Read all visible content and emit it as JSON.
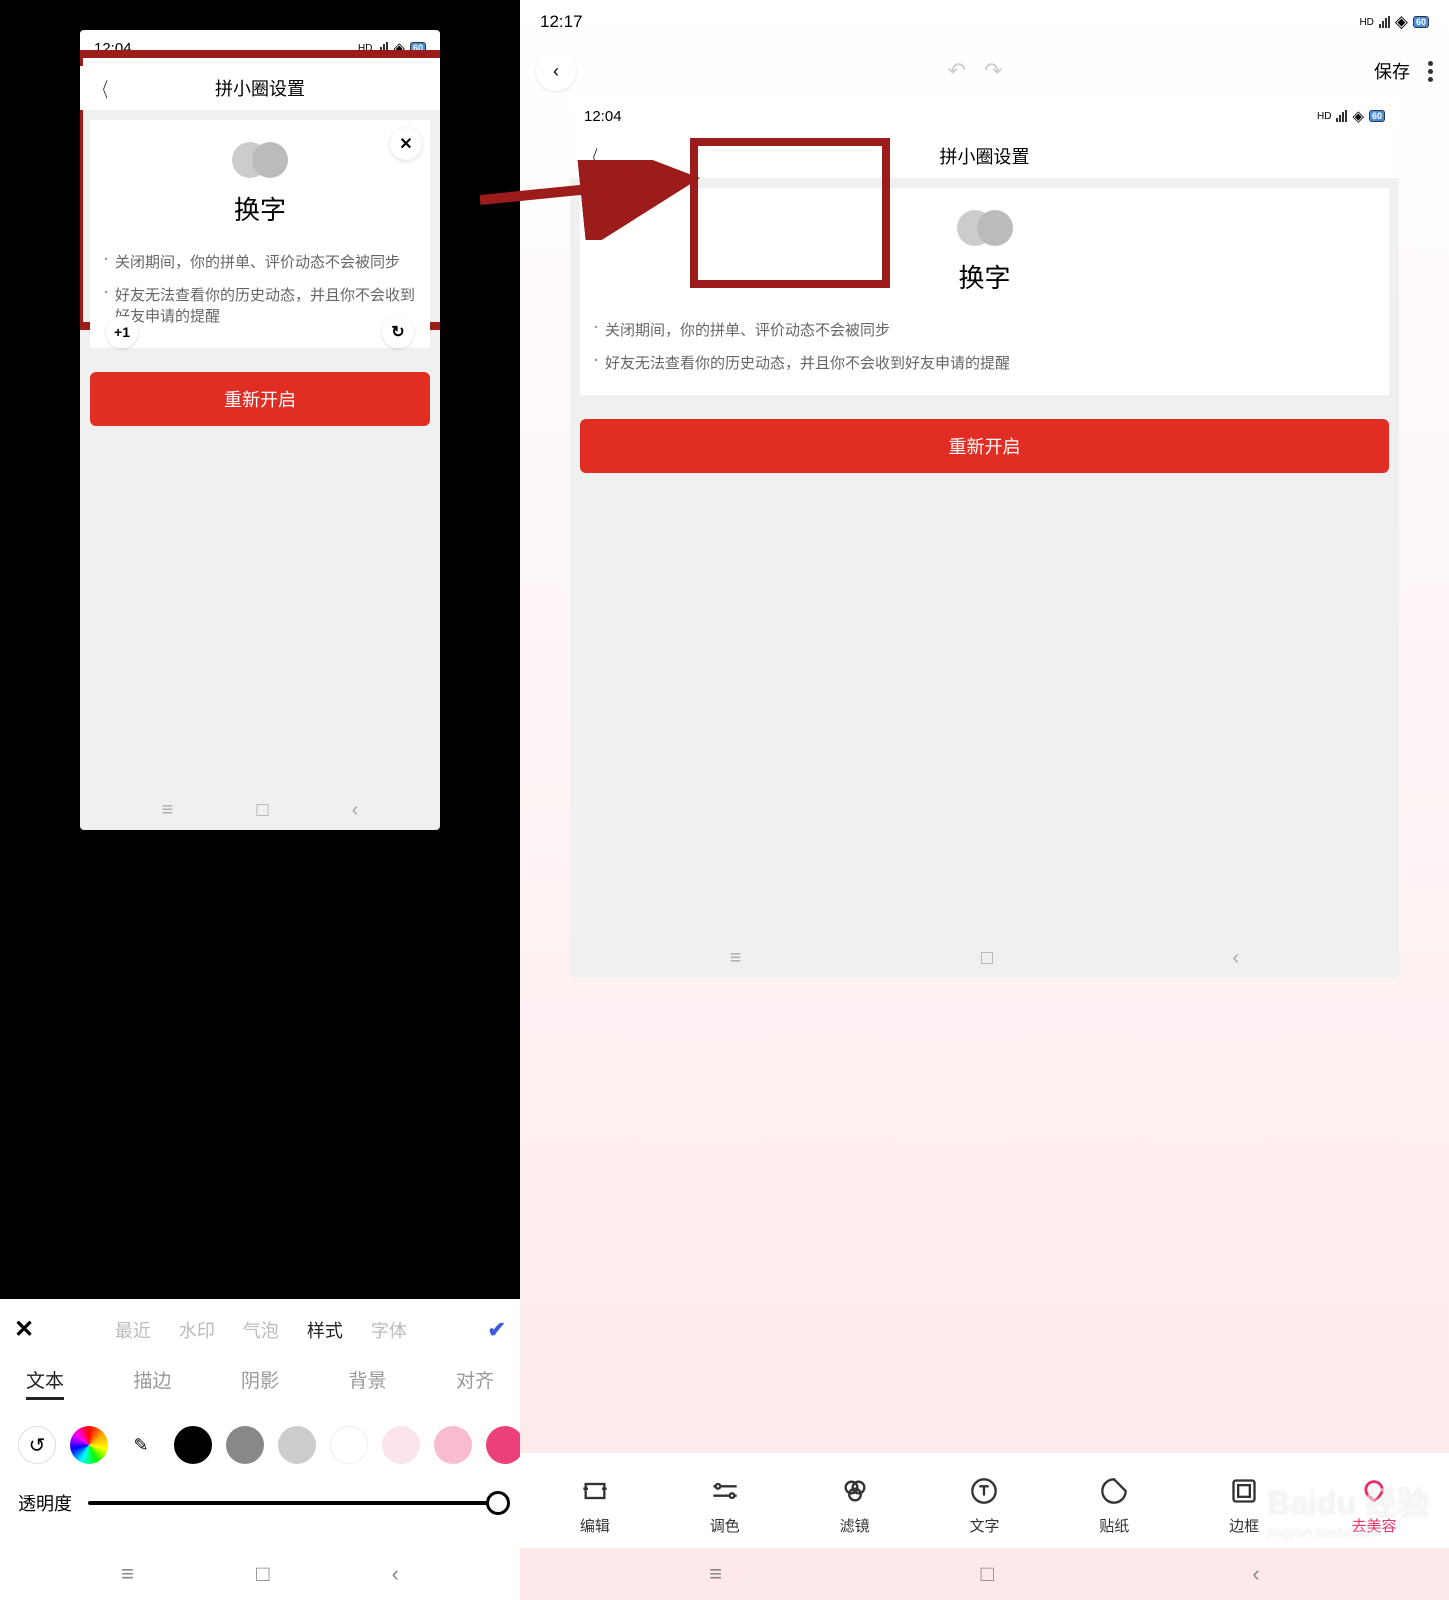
{
  "left": {
    "phone": {
      "status_time": "12:04",
      "header_title": "拼小圈设置",
      "huan_label": "换字",
      "bullet1": "关闭期间，你的拼单、评价动态不会被同步",
      "bullet2": "好友无法查看你的历史动态，并且你不会收到好友申请的提醒",
      "restart_btn": "重新开启",
      "plus_one": "+1"
    },
    "editor": {
      "close_icon": "✕",
      "check_icon": "✔",
      "tabs": [
        "最近",
        "水印",
        "气泡",
        "样式",
        "字体"
      ],
      "active_tab": "样式",
      "subtabs": [
        "文本",
        "描边",
        "阴影",
        "背景",
        "对齐"
      ],
      "active_subtab": "文本",
      "reset_icon": "↺",
      "picker_icon": "✎",
      "opacity_label": "透明度",
      "colors": [
        {
          "name": "black",
          "hex": "#000000",
          "selected": true
        },
        {
          "name": "gray",
          "hex": "#888888"
        },
        {
          "name": "lightgray",
          "hex": "#cccccc"
        },
        {
          "name": "white",
          "hex": "#ffffff",
          "border": "#eee"
        },
        {
          "name": "pink-light",
          "hex": "#fce4ec"
        },
        {
          "name": "pink",
          "hex": "#f8bbd0"
        },
        {
          "name": "hotpink",
          "hex": "#ec407a"
        }
      ]
    }
  },
  "right": {
    "status_time": "12:17",
    "battery": "60",
    "save_label": "保存",
    "phone": {
      "status_time": "12:04",
      "header_title": "拼小圈设置",
      "huan_label": "换字",
      "bullet1": "关闭期间，你的拼单、评价动态不会被同步",
      "bullet2": "好友无法查看你的历史动态，并且你不会收到好友申请的提醒",
      "restart_btn": "重新开启"
    },
    "tools": [
      {
        "icon": "crop",
        "label": "编辑"
      },
      {
        "icon": "tune",
        "label": "调色"
      },
      {
        "icon": "filter",
        "label": "滤镜"
      },
      {
        "icon": "text",
        "label": "文字"
      },
      {
        "icon": "sticker",
        "label": "贴纸"
      },
      {
        "icon": "frame",
        "label": "边框"
      },
      {
        "icon": "beauty",
        "label": "去美容",
        "pink": true
      }
    ]
  },
  "watermark": {
    "brand": "Baidu 经验",
    "url": "jingyan.baidu.com"
  }
}
